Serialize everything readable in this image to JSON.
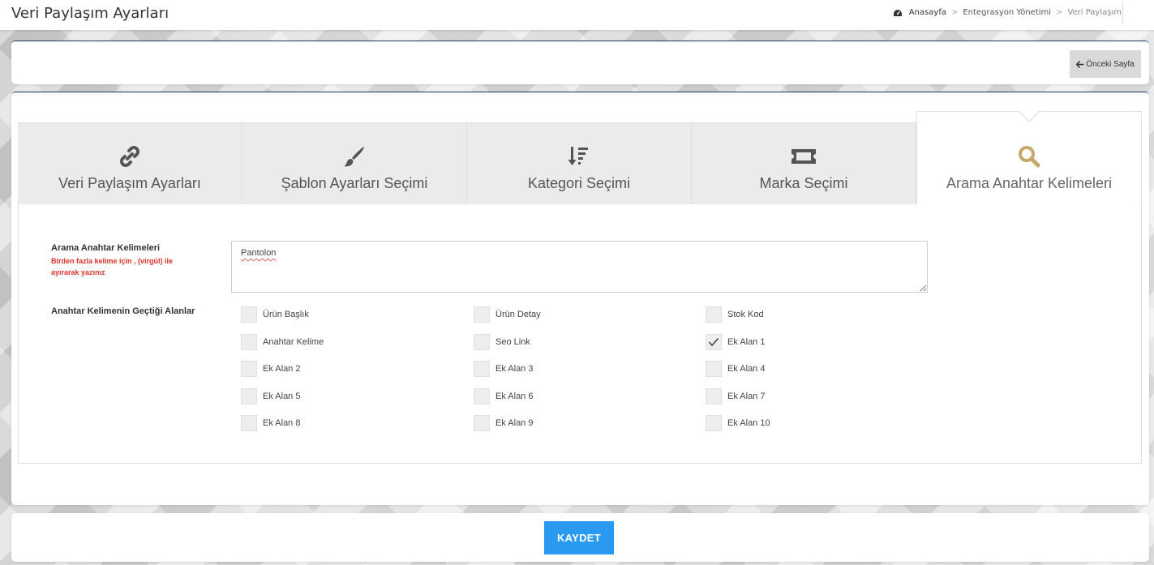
{
  "header": {
    "title": "Veri Paylaşım Ayarları",
    "breadcrumb": [
      "Anasayfa",
      "Entegrasyon Yönetimi",
      "Veri Paylaşım"
    ],
    "breadcrumb_sep": ">"
  },
  "toolbar": {
    "prev_label": "Önceki Sayfa"
  },
  "tabs": [
    {
      "label": "Veri Paylaşım Ayarları",
      "icon": "link-icon"
    },
    {
      "label": "Şablon Ayarları Seçimi",
      "icon": "brush-icon"
    },
    {
      "label": "Kategori Seçimi",
      "icon": "sort-icon"
    },
    {
      "label": "Marka Seçimi",
      "icon": "ticket-icon"
    },
    {
      "label": "Arama Anahtar Kelimeleri",
      "icon": "search-icon",
      "active": true
    }
  ],
  "form": {
    "keywords_label": "Arama Anahtar Kelimeleri",
    "keywords_hint": "Birden fazla kelime için , (virgül) ile ayırarak yazınız",
    "keywords_value": "Pantolon",
    "fields_label": "Anahtar Kelimenin Geçtiği Alanlar",
    "checkboxes": [
      {
        "label": "Ürün Başlık",
        "checked": false
      },
      {
        "label": "Ürün Detay",
        "checked": false
      },
      {
        "label": "Stok Kod",
        "checked": false
      },
      {
        "label": "Anahtar Kelime",
        "checked": false
      },
      {
        "label": "Seo Link",
        "checked": false
      },
      {
        "label": "Ek Alan 1",
        "checked": true
      },
      {
        "label": "Ek Alan 2",
        "checked": false
      },
      {
        "label": "Ek Alan 3",
        "checked": false
      },
      {
        "label": "Ek Alan 4",
        "checked": false
      },
      {
        "label": "Ek Alan 5",
        "checked": false
      },
      {
        "label": "Ek Alan 6",
        "checked": false
      },
      {
        "label": "Ek Alan 7",
        "checked": false
      },
      {
        "label": "Ek Alan 8",
        "checked": false
      },
      {
        "label": "Ek Alan 9",
        "checked": false
      },
      {
        "label": "Ek Alan 10",
        "checked": false
      }
    ]
  },
  "footer": {
    "save_label": "KAYDET"
  },
  "colors": {
    "accent_blue": "#2a99f0",
    "hint_red": "#d9332b",
    "active_icon": "#c5a86a",
    "tab_bg": "#ebebeb",
    "dark_icon": "#555555"
  }
}
